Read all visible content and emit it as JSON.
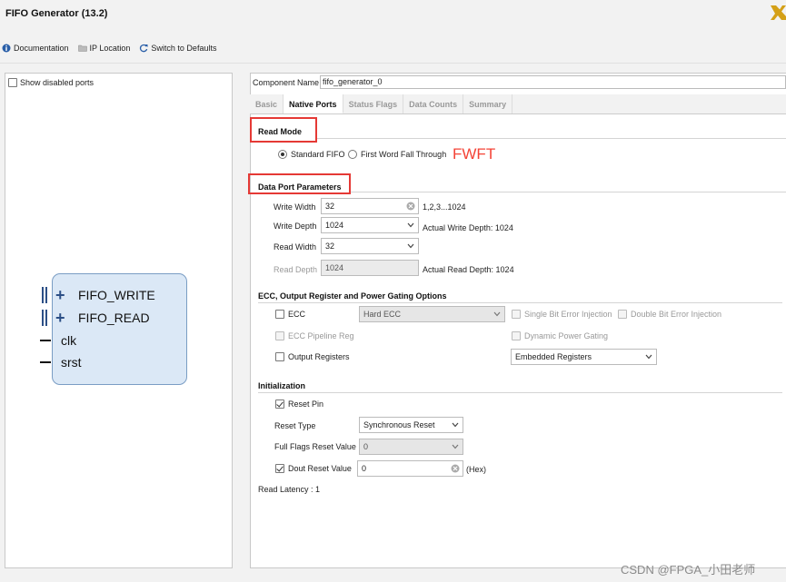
{
  "window": {
    "title": "FIFO Generator (13.2)"
  },
  "toolbar": {
    "documentation": "Documentation",
    "ip_location": "IP Location",
    "switch_defaults": "Switch to Defaults"
  },
  "left": {
    "show_disabled_ports": "Show disabled ports",
    "ports": [
      "FIFO_WRITE",
      "FIFO_READ",
      "clk",
      "srst"
    ]
  },
  "component": {
    "label": "Component Name",
    "value": "fifo_generator_0"
  },
  "tabs": [
    "Basic",
    "Native Ports",
    "Status Flags",
    "Data Counts",
    "Summary"
  ],
  "read_mode": {
    "title": "Read Mode",
    "standard": "Standard FIFO",
    "fwft": "First Word Fall Through",
    "annotation": "FWFT"
  },
  "data_port": {
    "title": "Data Port Parameters",
    "write_width_label": "Write Width",
    "write_width_value": "32",
    "write_width_hint": "1,2,3...1024",
    "write_depth_label": "Write Depth",
    "write_depth_value": "1024",
    "write_depth_hint": "Actual Write Depth: 1024",
    "read_width_label": "Read Width",
    "read_width_value": "32",
    "read_depth_label": "Read Depth",
    "read_depth_value": "1024",
    "read_depth_hint": "Actual Read Depth: 1024"
  },
  "ecc": {
    "title": "ECC, Output Register and Power Gating Options",
    "ecc_label": "ECC",
    "ecc_select": "Hard ECC",
    "single_bit": "Single Bit Error Injection",
    "double_bit": "Double Bit Error Injection",
    "ecc_pipeline": "ECC Pipeline Reg",
    "dynamic_power": "Dynamic Power Gating",
    "output_registers": "Output Registers",
    "output_select": "Embedded Registers"
  },
  "init": {
    "title": "Initialization",
    "reset_pin": "Reset Pin",
    "reset_type_label": "Reset Type",
    "reset_type_value": "Synchronous Reset",
    "full_flags_label": "Full Flags Reset Value",
    "full_flags_value": "0",
    "dout_label": "Dout Reset Value",
    "dout_value": "0",
    "dout_unit": "(Hex)",
    "read_latency": "Read Latency : 1"
  },
  "watermark": "CSDN @FPGA_小田老师"
}
